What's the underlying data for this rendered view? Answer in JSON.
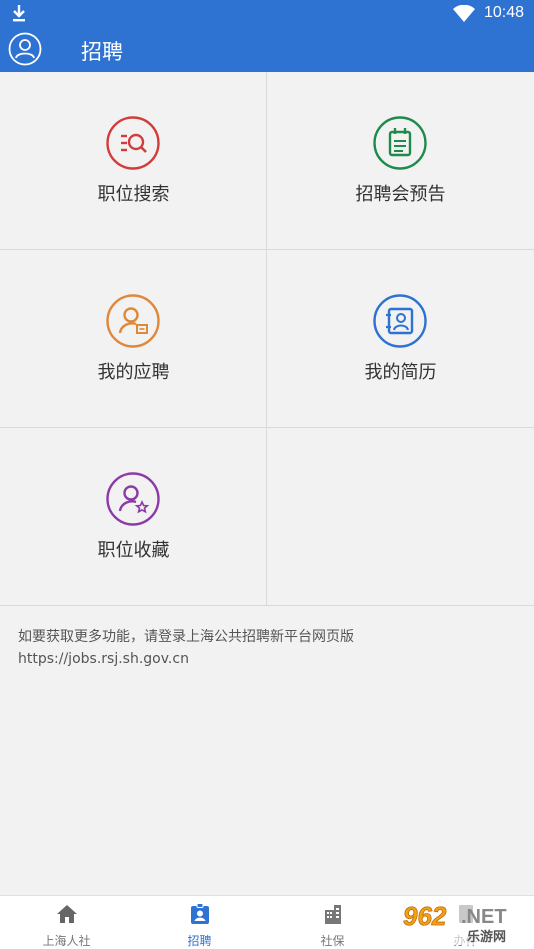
{
  "status": {
    "time": "10:48"
  },
  "header": {
    "title": "招聘"
  },
  "menu": {
    "items": [
      {
        "label": "职位搜索",
        "color": "#d43c3c",
        "icon": "job-search-icon"
      },
      {
        "label": "招聘会预告",
        "color": "#1f8a4c",
        "icon": "job-fair-notice-icon"
      },
      {
        "label": "我的应聘",
        "color": "#e0883a",
        "icon": "my-application-icon"
      },
      {
        "label": "我的简历",
        "color": "#2e73d2",
        "icon": "my-resume-icon"
      },
      {
        "label": "职位收藏",
        "color": "#8b3aa8",
        "icon": "job-favorite-icon"
      }
    ]
  },
  "hint": {
    "line1": "如要获取更多功能，请登录上海公共招聘新平台网页版",
    "line2": "https://jobs.rsj.sh.gov.cn"
  },
  "tabs": [
    {
      "label": "上海人社",
      "icon": "home-icon"
    },
    {
      "label": "招聘",
      "icon": "id-badge-icon",
      "active": true
    },
    {
      "label": "社保",
      "icon": "building-icon"
    },
    {
      "label": "办件",
      "icon": "document-icon"
    }
  ],
  "watermark": {
    "brand": "962",
    "suffix": ".NET",
    "sub": "乐游网"
  },
  "colors": {
    "primary": "#2e73d2",
    "background": "#f2f2f2"
  }
}
